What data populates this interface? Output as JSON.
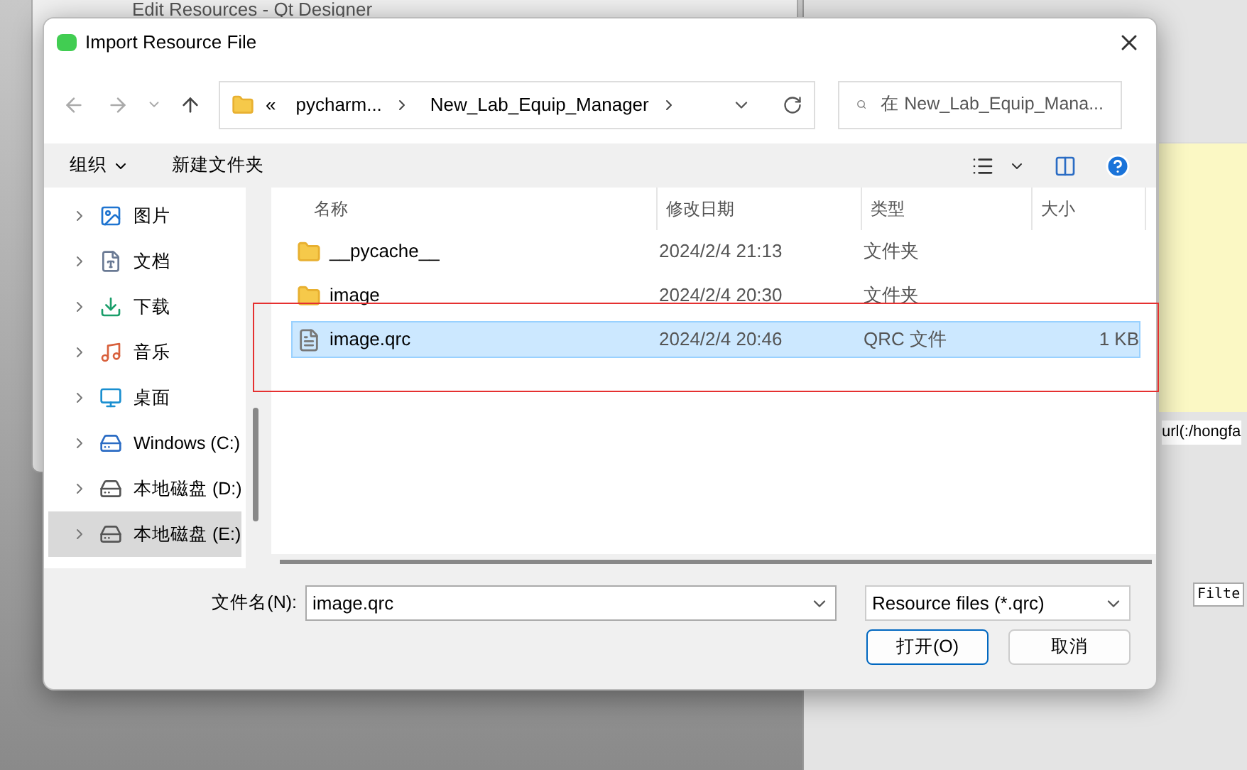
{
  "background": {
    "window_title": "Edit Resources - Qt Designer",
    "text_snippet": "url(:/hongfa",
    "filter_label": "Filte"
  },
  "dialog": {
    "title": "Import Resource File",
    "breadcrumb": {
      "overflow": "«",
      "items": [
        "pycharm...",
        "New_Lab_Equip_Manager"
      ]
    },
    "search": {
      "placeholder": "在 New_Lab_Equip_Mana..."
    },
    "toolbar": {
      "organize": "组织",
      "new_folder": "新建文件夹"
    },
    "sidebar": [
      {
        "label": "图片",
        "kind": "pictures",
        "selected": false
      },
      {
        "label": "文档",
        "kind": "documents",
        "selected": false
      },
      {
        "label": "下载",
        "kind": "downloads",
        "selected": false
      },
      {
        "label": "音乐",
        "kind": "music",
        "selected": false
      },
      {
        "label": "桌面",
        "kind": "desktop",
        "selected": false
      },
      {
        "label": "Windows (C:)",
        "kind": "system_drive",
        "selected": false
      },
      {
        "label": "本地磁盘 (D:)",
        "kind": "drive",
        "selected": false
      },
      {
        "label": "本地磁盘 (E:)",
        "kind": "drive",
        "selected": true
      }
    ],
    "columns": [
      "名称",
      "修改日期",
      "类型",
      "大小"
    ],
    "files": [
      {
        "name": "__pycache__",
        "kind": "folder",
        "modified": "2024/2/4 21:13",
        "type": "文件夹",
        "selected": false
      },
      {
        "name": "image",
        "kind": "folder",
        "modified": "2024/2/4 20:30",
        "type": "文件夹",
        "selected": false
      },
      {
        "name": "image.qrc",
        "kind": "file",
        "modified": "2024/2/4 20:46",
        "type": "QRC 文件",
        "size": "1 KB",
        "selected": true
      }
    ],
    "filename": {
      "label": "文件名(N):",
      "value": "image.qrc"
    },
    "file_type": "Resource files (*.qrc)",
    "buttons": [
      "打开(O)",
      "取消"
    ]
  }
}
